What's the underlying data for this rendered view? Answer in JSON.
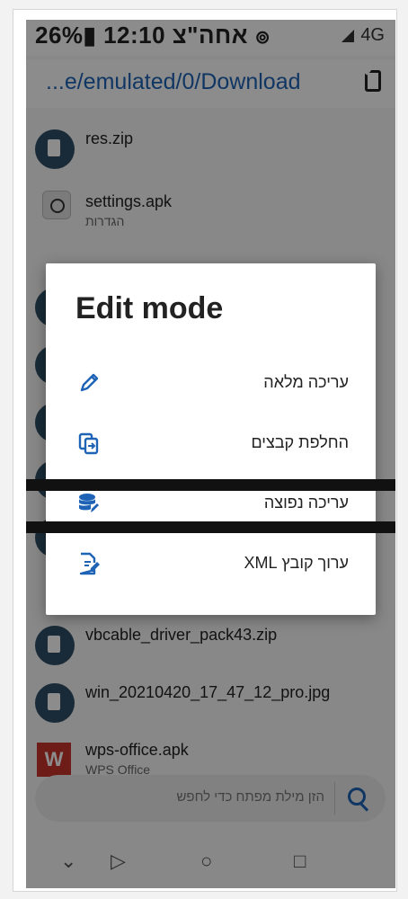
{
  "status": {
    "time": "12:10",
    "day": "אחה\"צ",
    "battery": "26%",
    "network": "4G"
  },
  "path": "...e/emulated/0/Download",
  "files": [
    {
      "name": "res.zip",
      "sub": ""
    },
    {
      "name": "settings.apk",
      "sub": "הגדרות"
    },
    {
      "name": "vbcable_driver_pack43.zip",
      "sub": ""
    },
    {
      "name": "win_20210420_17_47_12_pro.jpg",
      "sub": ""
    },
    {
      "name": "wps-office.apk",
      "sub": "WPS Office"
    }
  ],
  "search": {
    "placeholder": "הזן מילת מפתח כדי לחפש"
  },
  "dialog": {
    "title": "Edit mode",
    "options": [
      {
        "label": "עריכה מלאה",
        "icon": "pencil-icon"
      },
      {
        "label": "החלפת קבצים",
        "icon": "file-swap-icon"
      },
      {
        "label": "עריכה נפוצה",
        "icon": "database-edit-icon"
      },
      {
        "label": "ערוך קובץ XML",
        "icon": "file-edit-icon"
      }
    ]
  },
  "colors": {
    "accent": "#1e63b5",
    "scrim": "rgba(0,0,0,0.45)"
  }
}
